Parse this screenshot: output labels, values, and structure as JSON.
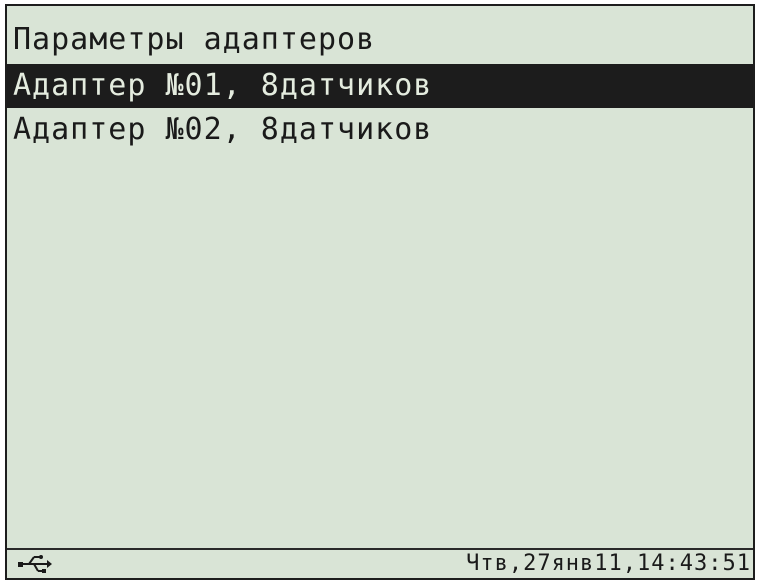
{
  "screen": {
    "title": "Параметры адаптеров",
    "menu": [
      {
        "label": "Адаптер №01, 8датчиков",
        "selected": true
      },
      {
        "label": "Адаптер №02, 8датчиков",
        "selected": false
      }
    ]
  },
  "status_bar": {
    "icon": "usb-icon",
    "datetime": "Чтв,27янв11,14:43:51"
  },
  "colors": {
    "lcd_background": "#d9e4d6",
    "text": "#1a1a1a",
    "selection_background": "#1c1c1c",
    "selection_text": "#e4ecdf"
  }
}
